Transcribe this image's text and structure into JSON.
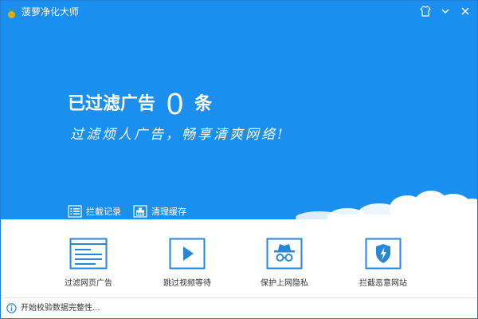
{
  "window": {
    "title": "菠萝净化大师"
  },
  "hero": {
    "headline_prefix": "已过滤广告",
    "count": "0",
    "headline_suffix": "条",
    "tagline": "过滤烦人广告，畅享清爽网络!",
    "links": [
      {
        "label": "拦截记录",
        "icon": "list-icon"
      },
      {
        "label": "清理缓存",
        "icon": "cleanup-icon"
      }
    ]
  },
  "features": [
    {
      "label": "过滤网页广告",
      "icon": "webpage-icon"
    },
    {
      "label": "跳过视频等待",
      "icon": "play-icon"
    },
    {
      "label": "保护上网隐私",
      "icon": "incognito-icon"
    },
    {
      "label": "拦截恶意网站",
      "icon": "shield-icon"
    }
  ],
  "status": {
    "text": "开始校验数据完整性..."
  },
  "colors": {
    "hero_blue": "#1a8ff0",
    "icon_blue": "#2a86d6",
    "text_dark": "#333333"
  }
}
